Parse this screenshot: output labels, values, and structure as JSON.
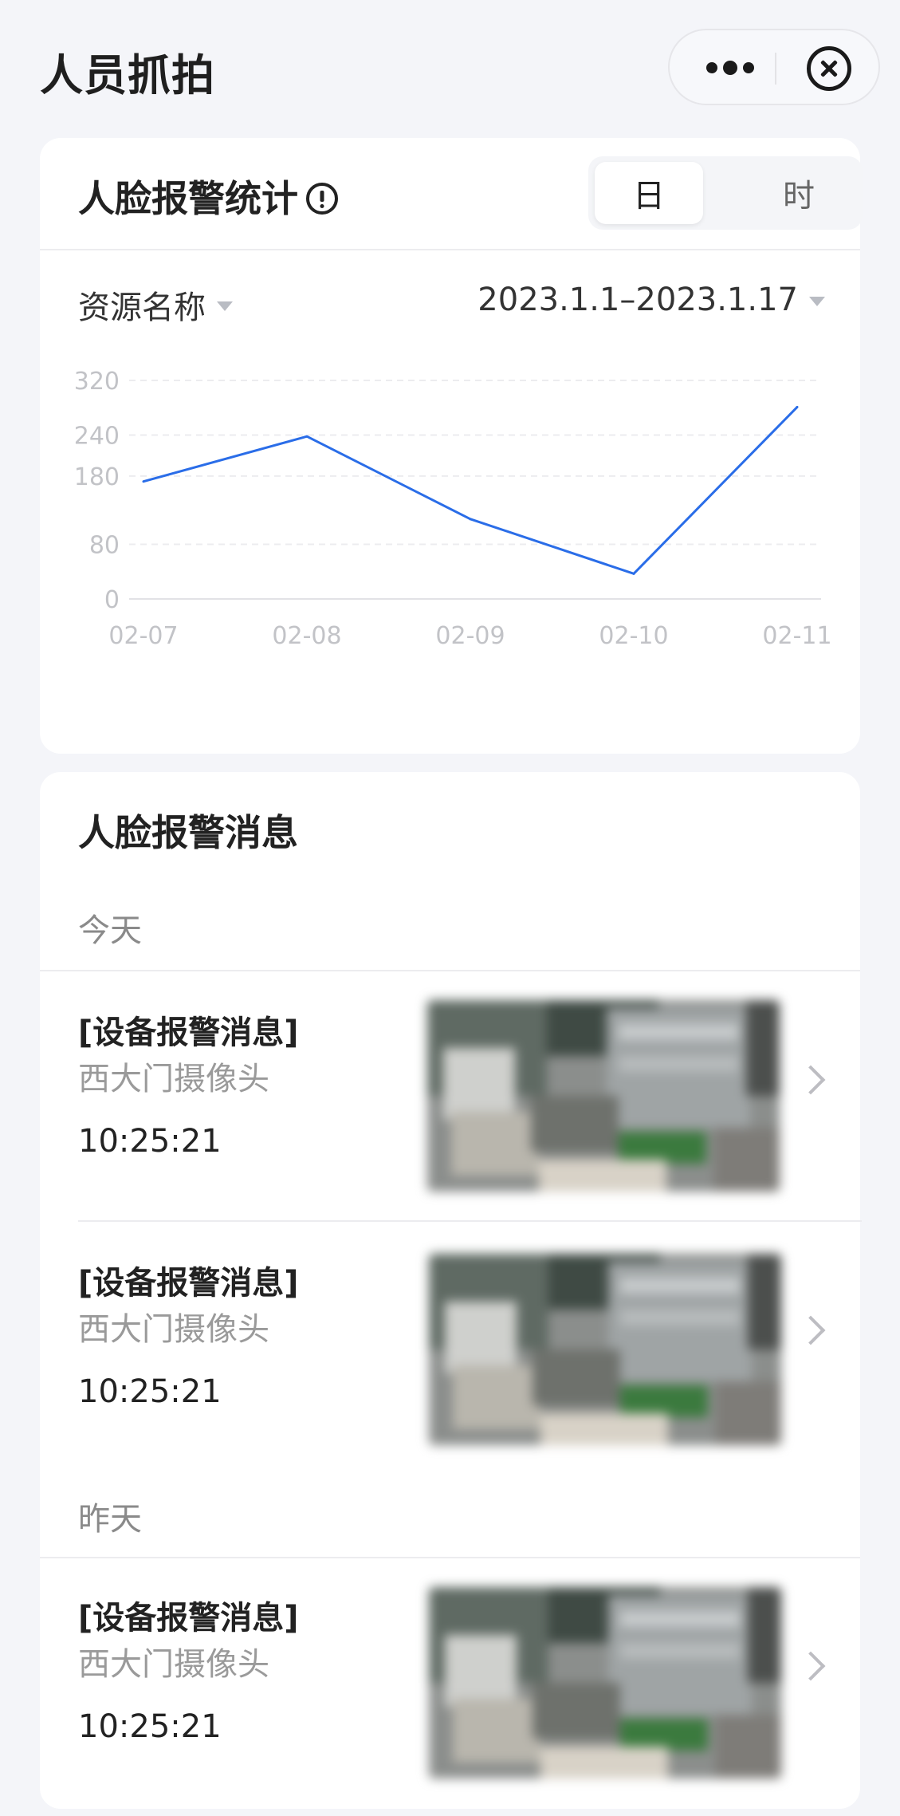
{
  "header": {
    "title": "人员抓拍",
    "more_icon": "more-dots-icon",
    "close_icon": "close-circle-icon"
  },
  "stats": {
    "title": "人脸报警统计",
    "info_icon": "info-circle-icon",
    "segments": [
      {
        "label": "日",
        "active": true
      },
      {
        "label": "时",
        "active": false
      }
    ],
    "resource_filter": "资源名称",
    "date_range": "2023.1.1–2023.1.17"
  },
  "chart_data": {
    "type": "line",
    "x": [
      "02-07",
      "02-08",
      "02-09",
      "02-10",
      "02-11"
    ],
    "series": [
      {
        "values": [
          172,
          238,
          117,
          37,
          281
        ],
        "color": "#2a6de8"
      }
    ],
    "y_ticks": [
      0,
      80,
      180,
      240,
      320
    ],
    "ylim": [
      0,
      320
    ],
    "grid": true,
    "title": "",
    "xlabel": "",
    "ylabel": ""
  },
  "messages": {
    "title": "人脸报警消息",
    "groups": [
      {
        "label": "今天",
        "items": [
          {
            "title": "[设备报警消息]",
            "source": "西大门摄像头",
            "time": "10:25:21"
          },
          {
            "title": "[设备报警消息]",
            "source": "西大门摄像头",
            "time": "10:25:21"
          }
        ]
      },
      {
        "label": "昨天",
        "items": [
          {
            "title": "[设备报警消息]",
            "source": "西大门摄像头",
            "time": "10:25:21"
          }
        ]
      }
    ]
  }
}
